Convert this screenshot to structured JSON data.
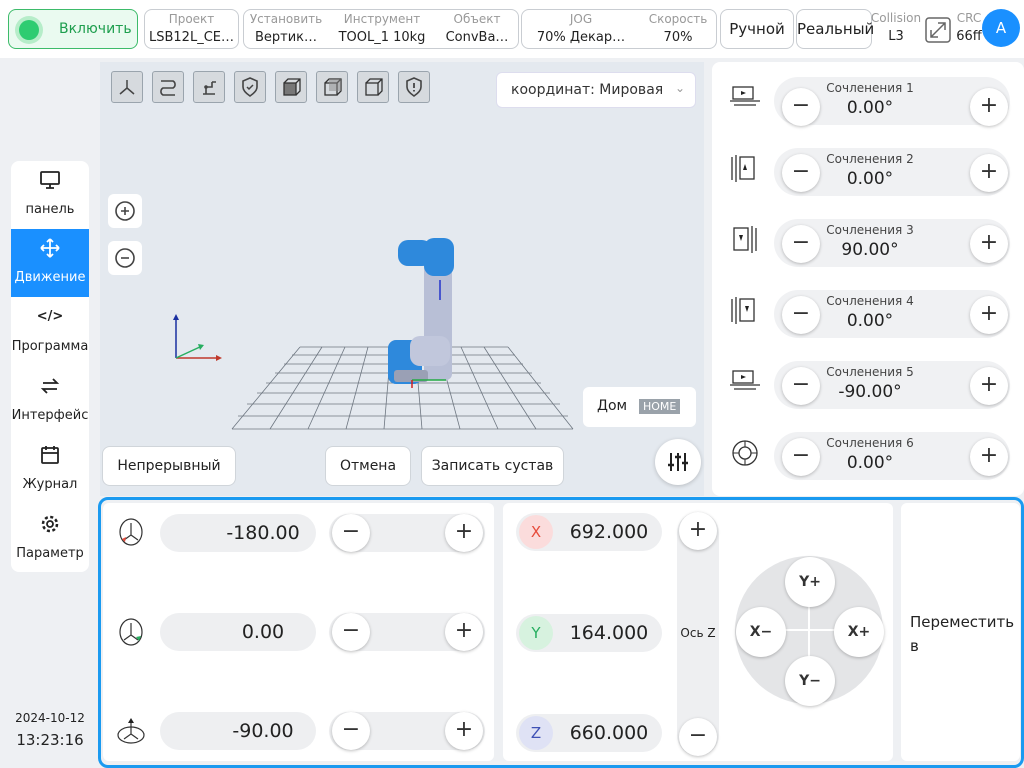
{
  "topbar": {
    "power_label": "Включить",
    "project": {
      "key": "Проект",
      "value": "LSB12L_CE…"
    },
    "install": {
      "key": "Установить",
      "value": "Вертик…"
    },
    "tool": {
      "key": "Инструмент",
      "value": "TOOL_1  10kg"
    },
    "object": {
      "key": "Объект",
      "value": "ConvBa…"
    },
    "jog": {
      "key": "JOG",
      "value": "70%   Декар…"
    },
    "speed": {
      "key": "Скорость",
      "value": "70%"
    },
    "manual_label": "Ручной",
    "real_label": "Реальный",
    "collision": {
      "key": "Collision",
      "value": "L3"
    },
    "crc": {
      "key": "CRC",
      "value": "66ff"
    },
    "avatar_letter": "A"
  },
  "sidebar": {
    "items": [
      {
        "label": "панель",
        "icon": "monitor-icon"
      },
      {
        "label": "Движение",
        "icon": "move-icon"
      },
      {
        "label": "Программа",
        "icon": "code-icon"
      },
      {
        "label": "Интерфейс",
        "icon": "swap-icon"
      },
      {
        "label": "Журнал",
        "icon": "calendar-icon"
      },
      {
        "label": "Параметр",
        "icon": "gear-icon"
      }
    ],
    "active": "Движение",
    "date": "2024-10-12",
    "time": "13:23:16"
  },
  "viewport": {
    "coord_label": "координат: Мировая",
    "home_label": "Дом",
    "home_badge": "HOME",
    "continuous_label": "Непрерывный",
    "cancel_label": "Отмена",
    "record_label": "Записать сустав"
  },
  "joints": [
    {
      "label": "Сочленения 1",
      "value": "0.00°"
    },
    {
      "label": "Сочленения 2",
      "value": "0.00°"
    },
    {
      "label": "Сочленения 3",
      "value": "90.00°"
    },
    {
      "label": "Сочленения 4",
      "value": "0.00°"
    },
    {
      "label": "Сочленения 5",
      "value": "-90.00°"
    },
    {
      "label": "Сочленения 6",
      "value": "0.00°"
    }
  ],
  "cartesian": {
    "rx": {
      "label": "RX",
      "value": "-180.00"
    },
    "ry": {
      "label": "RY",
      "value": "0.00"
    },
    "rz": {
      "label": "RZ",
      "value": "-90.00"
    },
    "x": {
      "label": "X",
      "value": "692.000"
    },
    "y": {
      "label": "Y",
      "value": "164.000"
    },
    "z": {
      "label": "Z",
      "value": "660.000"
    },
    "z_axis_label": "Ось Z",
    "dpad": {
      "up": "Y+",
      "down": "Y−",
      "left": "X−",
      "right": "X+"
    },
    "move_to_label": "Переместить в"
  },
  "colors": {
    "accent": "#1a90ff",
    "power": "#2ecc71",
    "rx": "#e74c3c",
    "ry": "#27ae60",
    "rz": "#3f51b5"
  }
}
